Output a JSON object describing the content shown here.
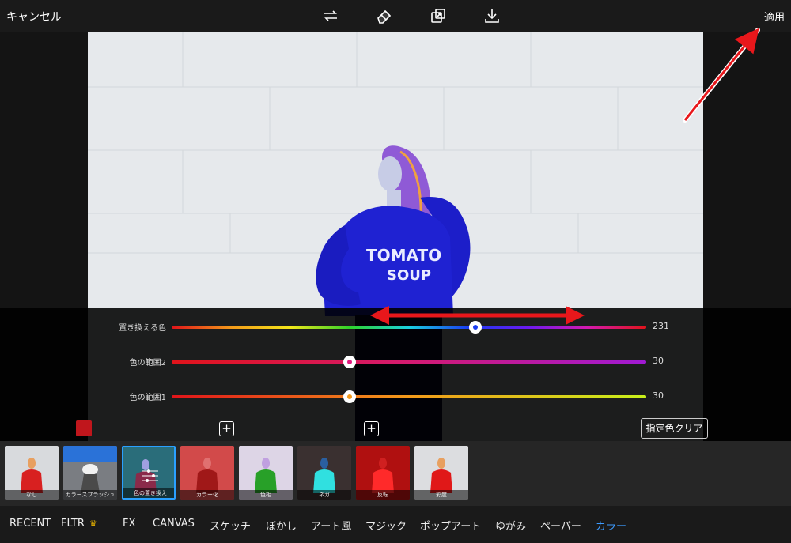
{
  "topbar": {
    "cancel_label": "キャンセル",
    "apply_label": "適用",
    "tools": [
      "sync-icon",
      "eraser-icon",
      "compare-icon",
      "download-icon"
    ]
  },
  "photo": {
    "sweatshirt_line1": "TOMATO",
    "sweatshirt_line2": "SOUP"
  },
  "sliders": [
    {
      "label": "置き換える色",
      "value": "231",
      "level": 0.64
    },
    {
      "label": "色の範囲2",
      "value": "30",
      "level": 0.375
    },
    {
      "label": "色の範囲1",
      "value": "30",
      "level": 0.375
    }
  ],
  "clear_button_label": "指定色クリア",
  "filters": [
    {
      "label": "なし"
    },
    {
      "label": "カラースプラッシュ"
    },
    {
      "label": "色の置き換え",
      "selected": true
    },
    {
      "label": "カラー化"
    },
    {
      "label": "色相"
    },
    {
      "label": "ネガ"
    },
    {
      "label": "反転"
    },
    {
      "label": "彩度"
    }
  ],
  "categories": [
    {
      "label": "RECENT"
    },
    {
      "label": "FLTR"
    },
    {
      "label": "FX"
    },
    {
      "label": "CANVAS"
    },
    {
      "label": "スケッチ"
    },
    {
      "label": "ぼかし"
    },
    {
      "label": "アート風"
    },
    {
      "label": "マジック"
    },
    {
      "label": "ポップアート"
    },
    {
      "label": "ゆがみ"
    },
    {
      "label": "ペーパー"
    },
    {
      "label": "カラー",
      "active": true
    }
  ],
  "colors": {
    "swatch": "#c0161c",
    "active_category": "#3d9bff",
    "annotation_arrow": "#e8171b"
  }
}
